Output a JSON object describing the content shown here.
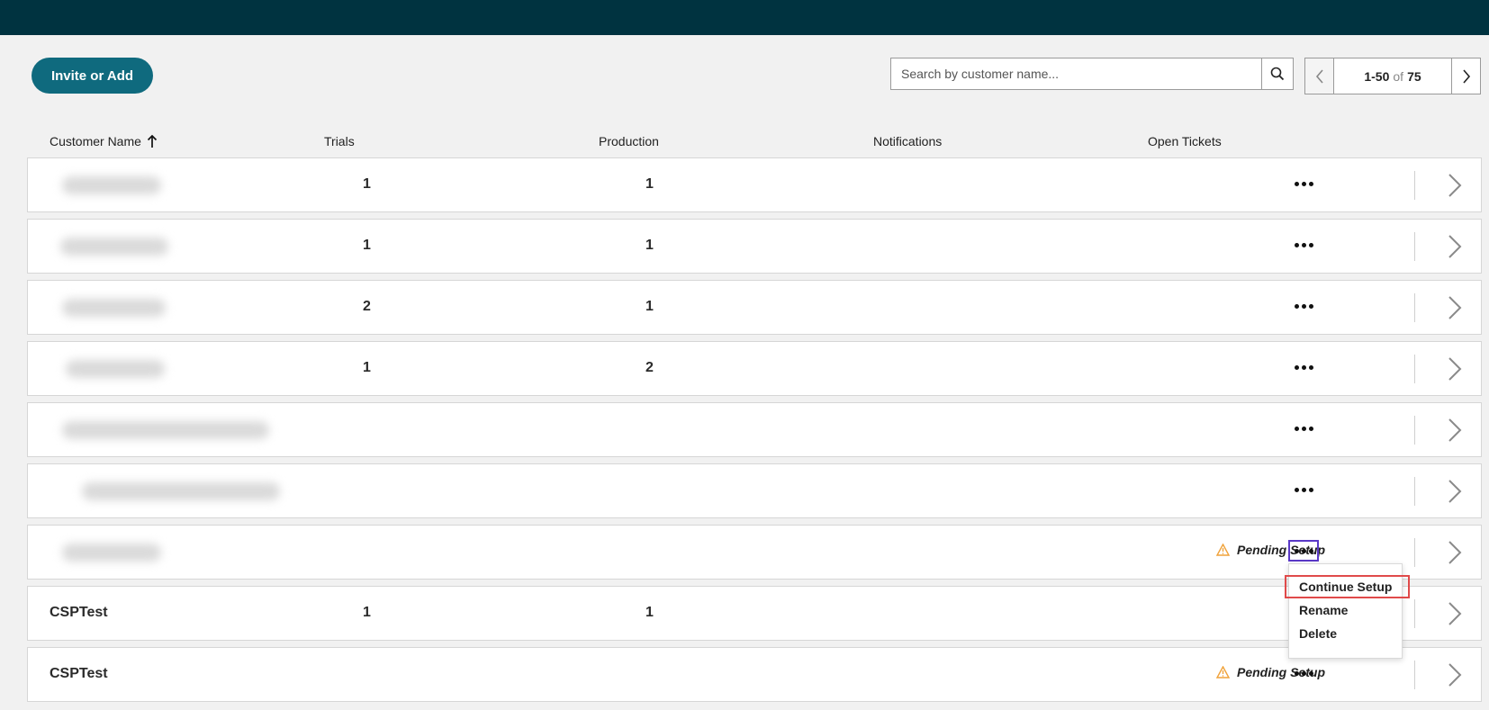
{
  "header": {},
  "toolbar": {
    "invite_label": "Invite or Add",
    "search_placeholder": "Search by customer name...",
    "pagination": {
      "range": "1-50",
      "of": "of",
      "total": "75"
    }
  },
  "table": {
    "columns": [
      "Customer Name",
      "Trials",
      "Production",
      "Notifications",
      "Open Tickets"
    ],
    "sort": {
      "column": "Customer Name",
      "direction": "ascending"
    },
    "rows": [
      {
        "name": "",
        "trials": "1",
        "production": "1",
        "status": ""
      },
      {
        "name": "",
        "trials": "1",
        "production": "1",
        "status": ""
      },
      {
        "name": "",
        "trials": "2",
        "production": "1",
        "status": ""
      },
      {
        "name": "",
        "trials": "1",
        "production": "2",
        "status": ""
      },
      {
        "name": "",
        "trials": "",
        "production": "",
        "status": ""
      },
      {
        "name": "",
        "trials": "",
        "production": "",
        "status": ""
      },
      {
        "name": "",
        "trials": "",
        "production": "",
        "status": "Pending Setup"
      },
      {
        "name": "CSPTest",
        "trials": "1",
        "production": "1",
        "status": ""
      },
      {
        "name": "CSPTest",
        "trials": "",
        "production": "",
        "status": "Pending Setup"
      }
    ]
  },
  "context_menu": {
    "items": [
      "Continue Setup",
      "Rename",
      "Delete"
    ],
    "highlighted": "Continue Setup"
  },
  "colors": {
    "topbar": "#003340",
    "primary_button": "#0f6a7e",
    "warning_icon": "#f0a23a",
    "focus_ring": "#5a39c7",
    "highlight_box": "#e04a4a"
  },
  "icons": [
    "search-icon",
    "chevron-left-icon",
    "chevron-right-icon",
    "sort-arrow-up-icon",
    "more-icon",
    "warning-icon",
    "row-chevron-icon"
  ]
}
